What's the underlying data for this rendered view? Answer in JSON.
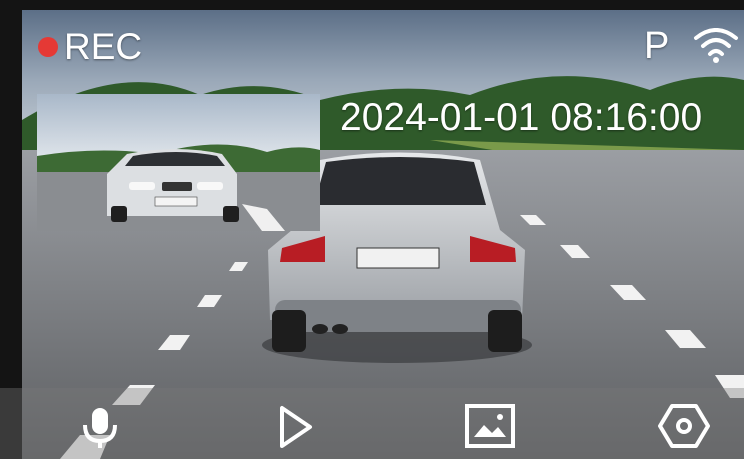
{
  "status": {
    "rec_label": "REC",
    "parking_label": "P",
    "timestamp": "2024-01-01 08:16:00"
  },
  "icons": {
    "rec": "record-dot-icon",
    "wifi": "wifi-icon",
    "mic": "microphone-icon",
    "play": "play-icon",
    "gallery": "gallery-icon",
    "settings": "settings-icon"
  },
  "colors": {
    "rec_dot": "#e53935",
    "overlay_text": "#ffffff",
    "toolbar_bg": "rgba(120,120,120,0.38)"
  }
}
